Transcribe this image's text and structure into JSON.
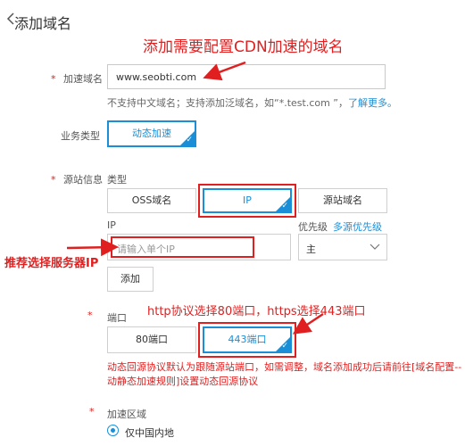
{
  "header": {
    "title": "添加域名"
  },
  "annotations": {
    "top": "添加需要配置CDN加速的域名",
    "left": "推荐选择服务器IP",
    "port": "http协议选择80端口，https选择443端口"
  },
  "form": {
    "required_mark": "*",
    "domain": {
      "label": "加速域名",
      "value": "www.seobti.com",
      "hint": "不支持中文域名；支持添加泛域名，如“*.test.com ”，",
      "hint_link": "了解更多。"
    },
    "business_type": {
      "label": "业务类型",
      "option": "动态加速"
    },
    "origin": {
      "label": "源站信息",
      "type_label": "类型",
      "options": [
        "OSS域名",
        "IP",
        "源站域名"
      ],
      "selected": "IP",
      "ip_label": "IP",
      "ip_placeholder": "请输入单个IP",
      "priority_label": "优先级",
      "multi_priority_link": "多源优先级",
      "priority_value": "主",
      "add_button": "添加"
    },
    "port": {
      "label": "端口",
      "options": [
        "80端口",
        "443端口"
      ],
      "selected": "443端口",
      "help": "动态回源协议默认为跟随源站端口，如需调整，域名添加成功后请前往[域名配置--动静态加速规则]设置动态回源协议"
    },
    "region": {
      "label": "加速区域",
      "option": "仅中国内地"
    }
  },
  "colors": {
    "accent": "#1a8fd8",
    "annotation": "#e02020"
  }
}
